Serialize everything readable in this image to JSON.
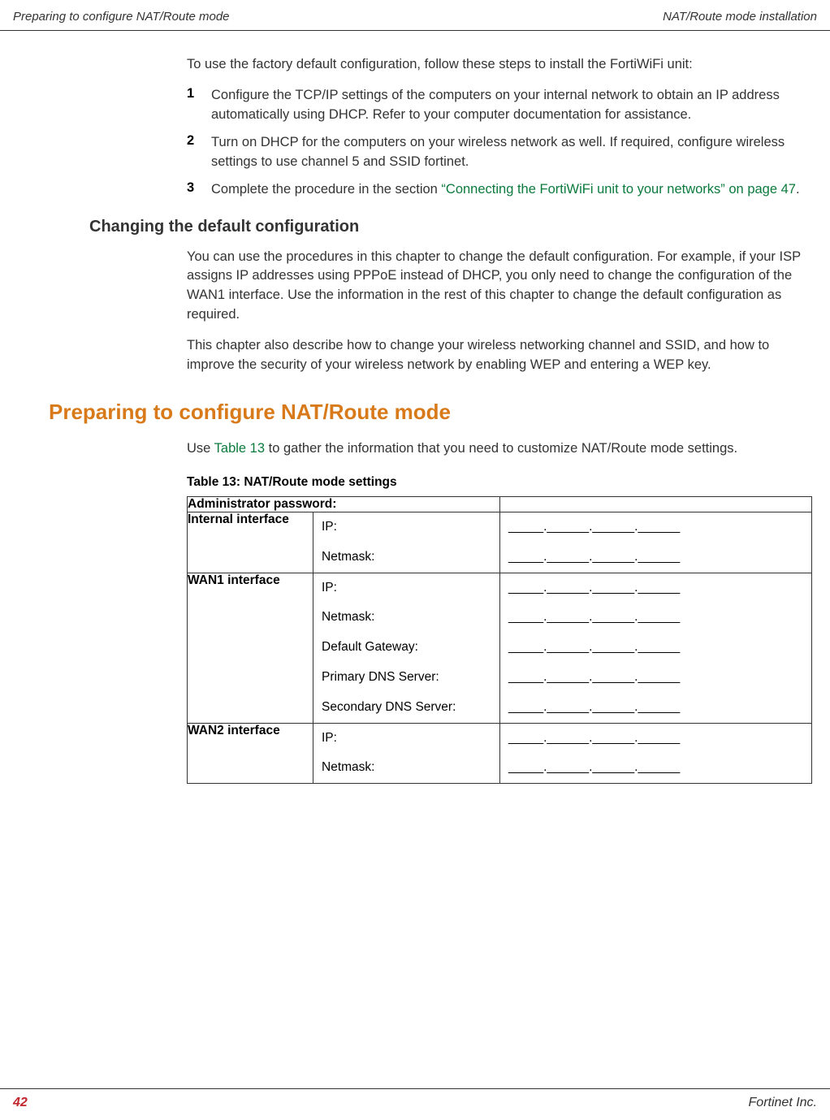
{
  "header": {
    "left": "Preparing to configure NAT/Route mode",
    "right": "NAT/Route mode installation"
  },
  "intro": "To use the factory default configuration, follow these steps to install the FortiWiFi unit:",
  "steps": [
    {
      "num": "1",
      "text": "Configure the TCP/IP settings of the computers on your internal network to obtain an IP address automatically using DHCP. Refer to your computer documentation for assistance."
    },
    {
      "num": "2",
      "text": "Turn on DHCP for the computers on your wireless network as well. If required, configure wireless settings to use channel 5 and SSID fortinet."
    },
    {
      "num": "3",
      "text_before": "Complete the procedure in the section ",
      "link": "“Connecting the FortiWiFi unit to your networks” on page 47",
      "text_after": "."
    }
  ],
  "h3": "Changing the default configuration",
  "para1": "You can use the procedures in this chapter to change the default configuration. For example, if your ISP assigns IP addresses using PPPoE instead of DHCP, you only need to change the configuration of the WAN1 interface. Use the information in the rest of this chapter to change the default configuration as required.",
  "para2": "This chapter also describe how to change your wireless networking channel and SSID, and how to improve the security of your wireless network by enabling WEP and entering a WEP key.",
  "h2": "Preparing to configure NAT/Route mode",
  "para3_before": "Use ",
  "para3_link": "Table 13",
  "para3_after": " to gather the information that you need to customize NAT/Route mode settings.",
  "table_caption": "Table 13: NAT/Route mode settings",
  "table": {
    "admin_label": "Administrator password:",
    "blank_ip": "_____.______.______.______",
    "rows": [
      {
        "label": "Internal interface",
        "fields": [
          "IP:",
          "Netmask:"
        ]
      },
      {
        "label": "WAN1 interface",
        "fields": [
          "IP:",
          "Netmask:",
          "Default Gateway:",
          "Primary DNS Server:",
          "Secondary DNS Server:"
        ]
      },
      {
        "label": "WAN2 interface",
        "fields": [
          "IP:",
          "Netmask:"
        ]
      }
    ]
  },
  "footer": {
    "page": "42",
    "right": "Fortinet Inc."
  }
}
